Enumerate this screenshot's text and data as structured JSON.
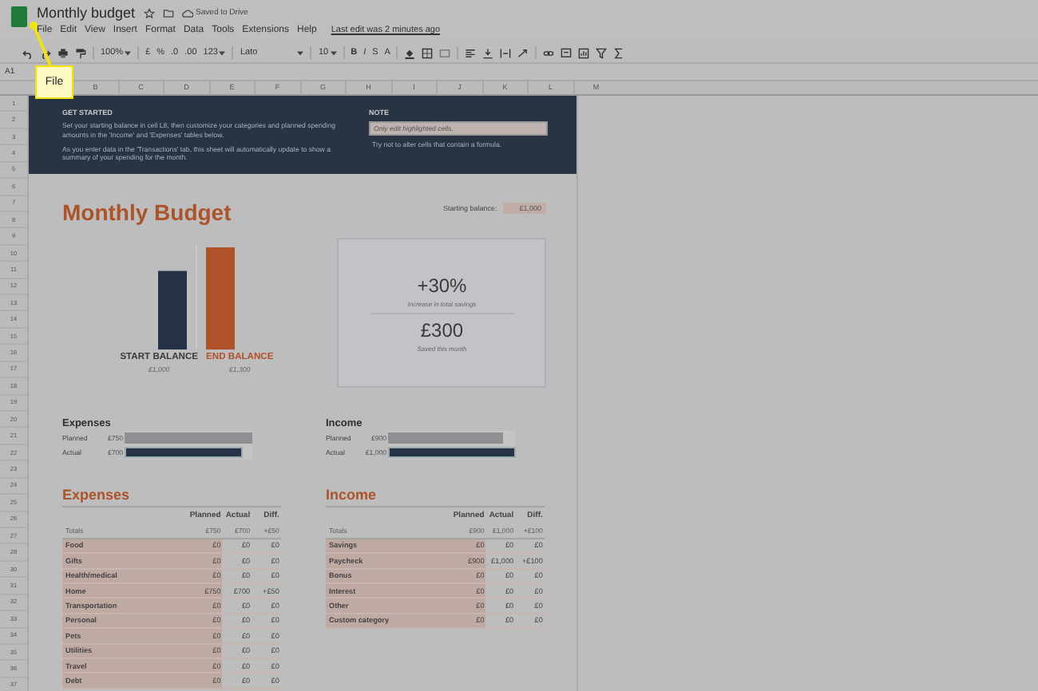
{
  "app": {
    "title": "Monthly budget",
    "saved": "Saved to Drive",
    "last_edit": "Last edit was 2 minutes ago",
    "menu": [
      {
        "label": "File"
      },
      {
        "label": "Edit"
      },
      {
        "label": "View"
      },
      {
        "label": "Insert"
      },
      {
        "label": "Format"
      },
      {
        "label": "Data"
      },
      {
        "label": "Tools"
      },
      {
        "label": "Extensions"
      },
      {
        "label": "Help"
      }
    ]
  },
  "toolbar": {
    "zoom": "100%",
    "currency": "£",
    "percent": "%",
    "decrease_decimals": ".0",
    "increase_decimals": ".00",
    "more_formats": "123",
    "font": "Lato",
    "font_size": "10",
    "bold": "B",
    "italic": "I",
    "strikethrough": "S",
    "text_color": "A"
  },
  "name_box": "A1",
  "callout": "File",
  "column_headers": [
    "B",
    "C",
    "D",
    "E",
    "F",
    "G",
    "H",
    "I",
    "J",
    "K",
    "L",
    "M"
  ],
  "row_numbers": [
    "1",
    "2",
    "3",
    "4",
    "5",
    "6",
    "7",
    "8",
    "9",
    "10",
    "11",
    "12",
    "13",
    "14",
    "15",
    "16",
    "17",
    "18",
    "19",
    "20",
    "21",
    "22",
    "23",
    "24",
    "25",
    "26",
    "27",
    "28",
    "30",
    "31",
    "32",
    "33",
    "34",
    "35",
    "36",
    "37"
  ],
  "banner": {
    "heading": "GET STARTED",
    "paragraphs": [
      "Set your starting balance in cell L8, then customize your categories and planned spending amounts in the 'Income' and 'Expenses' tables below.",
      "As you enter data in the 'Transactions' tab, this sheet will automatically update to show a summary of your spending for the month."
    ],
    "note_heading": "NOTE",
    "note_field": "Only edit highlighted cells.",
    "note_text": "Try not to alter cells that contain a formula."
  },
  "title": "Monthly Budget",
  "starting_balance": {
    "label": "Starting balance:",
    "value": "£1,000"
  },
  "balance_chart": {
    "chart_data": {
      "type": "bar",
      "categories": [
        "START BALANCE",
        "END BALANCE"
      ],
      "values": [
        1000,
        1300
      ],
      "colors": [
        "#263246",
        "#b0532a"
      ],
      "value_labels": [
        "£1,000",
        "£1,300"
      ]
    }
  },
  "savings": [
    {
      "value": "+30%",
      "caption": "Increase in total savings"
    },
    {
      "value": "£300",
      "caption": "Saved this month"
    }
  ],
  "summary": [
    {
      "title": "Expenses",
      "bars": [
        {
          "label": "Planned",
          "amount": "£750",
          "kind": "planned",
          "level": 1
        },
        {
          "label": "Actual",
          "amount": "£700",
          "kind": "actual",
          "level": 0.93
        }
      ]
    },
    {
      "title": "Income",
      "bars": [
        {
          "label": "Planned",
          "amount": "£900",
          "kind": "planned",
          "level": 0.9
        },
        {
          "label": "Actual",
          "amount": "£1,000",
          "kind": "actual",
          "level": 1
        }
      ]
    }
  ],
  "tables": [
    {
      "title": "Expenses",
      "columns": [
        "Planned",
        "Actual",
        "Diff."
      ],
      "totals": {
        "label": "Totals",
        "values": [
          "£750",
          "£700",
          "+£50"
        ]
      },
      "rows": [
        {
          "category": "Food",
          "values": [
            "£0",
            "£0",
            "£0"
          ]
        },
        {
          "category": "Gifts",
          "values": [
            "£0",
            "£0",
            "£0"
          ]
        },
        {
          "category": "Health/medical",
          "values": [
            "£0",
            "£0",
            "£0"
          ]
        },
        {
          "category": "Home",
          "values": [
            "£750",
            "£700",
            "+£50"
          ]
        },
        {
          "category": "Transportation",
          "values": [
            "£0",
            "£0",
            "£0"
          ]
        },
        {
          "category": "Personal",
          "values": [
            "£0",
            "£0",
            "£0"
          ]
        },
        {
          "category": "Pets",
          "values": [
            "£0",
            "£0",
            "£0"
          ]
        },
        {
          "category": "Utilities",
          "values": [
            "£0",
            "£0",
            "£0"
          ]
        },
        {
          "category": "Travel",
          "values": [
            "£0",
            "£0",
            "£0"
          ]
        },
        {
          "category": "Debt",
          "values": [
            "£0",
            "£0",
            "£0"
          ]
        }
      ]
    },
    {
      "title": "Income",
      "columns": [
        "Planned",
        "Actual",
        "Diff."
      ],
      "totals": {
        "label": "Totals",
        "values": [
          "£900",
          "£1,000",
          "+£100"
        ]
      },
      "rows": [
        {
          "category": "Savings",
          "values": [
            "£0",
            "£0",
            "£0"
          ]
        },
        {
          "category": "Paycheck",
          "values": [
            "£900",
            "£1,000",
            "+£100"
          ]
        },
        {
          "category": "Bonus",
          "values": [
            "£0",
            "£0",
            "£0"
          ]
        },
        {
          "category": "Interest",
          "values": [
            "£0",
            "£0",
            "£0"
          ]
        },
        {
          "category": "Other",
          "values": [
            "£0",
            "£0",
            "£0"
          ]
        },
        {
          "category": "Custom category",
          "values": [
            "£0",
            "£0",
            "£0"
          ]
        }
      ]
    }
  ]
}
